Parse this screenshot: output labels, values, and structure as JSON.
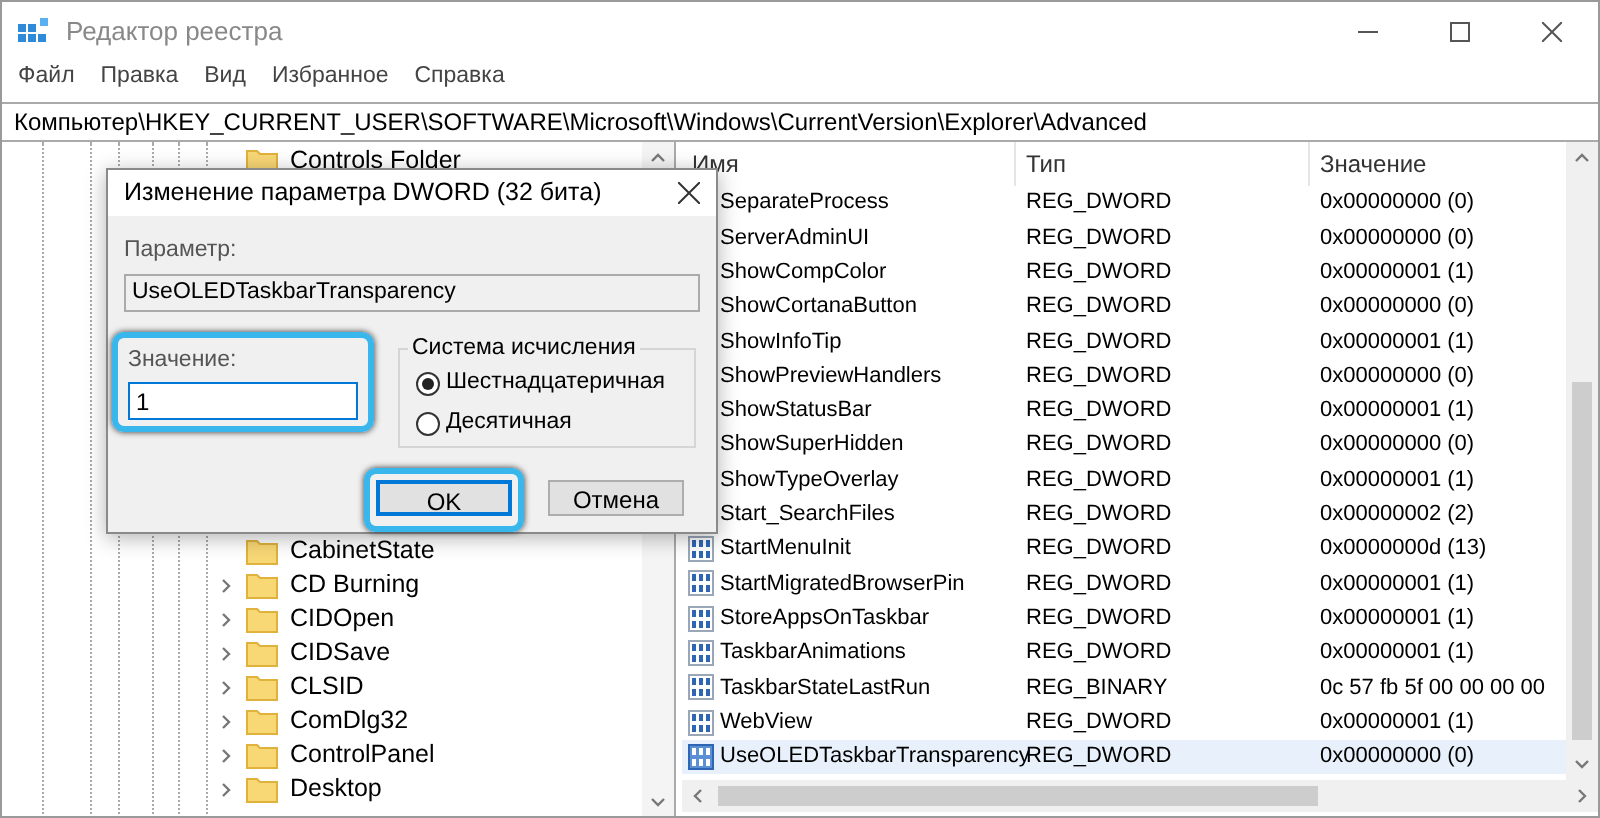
{
  "window": {
    "title": "Редактор реестра"
  },
  "menu": [
    "Файл",
    "Правка",
    "Вид",
    "Избранное",
    "Справка"
  ],
  "address": "Компьютер\\HKEY_CURRENT_USER\\SOFTWARE\\Microsoft\\Windows\\CurrentVersion\\Explorer\\Advanced",
  "tree": [
    {
      "label": "Controls Folder",
      "has_children": false
    },
    {
      "label": "CabinetState",
      "has_children": false,
      "gap_before": true
    },
    {
      "label": "CD Burning",
      "has_children": true
    },
    {
      "label": "CIDOpen",
      "has_children": true
    },
    {
      "label": "CIDSave",
      "has_children": true
    },
    {
      "label": "CLSID",
      "has_children": true
    },
    {
      "label": "ComDlg32",
      "has_children": true
    },
    {
      "label": "ControlPanel",
      "has_children": true
    },
    {
      "label": "Desktop",
      "has_children": true
    }
  ],
  "table": {
    "columns": [
      "Имя",
      "Тип",
      "Значение"
    ],
    "rows": [
      {
        "name": "SeparateProcess",
        "type": "REG_DWORD",
        "value": "0x00000000 (0)",
        "selected": false
      },
      {
        "name": "ServerAdminUI",
        "type": "REG_DWORD",
        "value": "0x00000000 (0)",
        "selected": false
      },
      {
        "name": "ShowCompColor",
        "type": "REG_DWORD",
        "value": "0x00000001 (1)",
        "selected": false
      },
      {
        "name": "ShowCortanaButton",
        "type": "REG_DWORD",
        "value": "0x00000000 (0)",
        "selected": false
      },
      {
        "name": "ShowInfoTip",
        "type": "REG_DWORD",
        "value": "0x00000001 (1)",
        "selected": false
      },
      {
        "name": "ShowPreviewHandlers",
        "type": "REG_DWORD",
        "value": "0x00000000 (0)",
        "selected": false
      },
      {
        "name": "ShowStatusBar",
        "type": "REG_DWORD",
        "value": "0x00000001 (1)",
        "selected": false
      },
      {
        "name": "ShowSuperHidden",
        "type": "REG_DWORD",
        "value": "0x00000000 (0)",
        "selected": false
      },
      {
        "name": "ShowTypeOverlay",
        "type": "REG_DWORD",
        "value": "0x00000001 (1)",
        "selected": false
      },
      {
        "name": "Start_SearchFiles",
        "type": "REG_DWORD",
        "value": "0x00000002 (2)",
        "selected": false
      },
      {
        "name": "StartMenuInit",
        "type": "REG_DWORD",
        "value": "0x0000000d (13)",
        "selected": false
      },
      {
        "name": "StartMigratedBrowserPin",
        "type": "REG_DWORD",
        "value": "0x00000001 (1)",
        "selected": false
      },
      {
        "name": "StoreAppsOnTaskbar",
        "type": "REG_DWORD",
        "value": "0x00000001 (1)",
        "selected": false
      },
      {
        "name": "TaskbarAnimations",
        "type": "REG_DWORD",
        "value": "0x00000001 (1)",
        "selected": false
      },
      {
        "name": "TaskbarStateLastRun",
        "type": "REG_BINARY",
        "value": "0c 57 fb 5f 00 00 00 00",
        "selected": false
      },
      {
        "name": "WebView",
        "type": "REG_DWORD",
        "value": "0x00000001 (1)",
        "selected": false
      },
      {
        "name": "UseOLEDTaskbarTransparency",
        "type": "REG_DWORD",
        "value": "0x00000000 (0)",
        "selected": true
      }
    ]
  },
  "dialog": {
    "title": "Изменение параметра DWORD (32 бита)",
    "name_label": "Параметр:",
    "name_value": "UseOLEDTaskbarTransparency",
    "value_label": "Значение:",
    "value": "1",
    "value_highlighted": true,
    "base_group": "Система исчисления",
    "bases": [
      {
        "label": "Шестнадцатеричная",
        "selected": true
      },
      {
        "label": "Десятичная",
        "selected": false
      }
    ],
    "buttons": [
      {
        "label": "OK",
        "default": true,
        "highlighted": true
      },
      {
        "label": "Отмена",
        "default": false,
        "highlighted": false
      }
    ]
  }
}
